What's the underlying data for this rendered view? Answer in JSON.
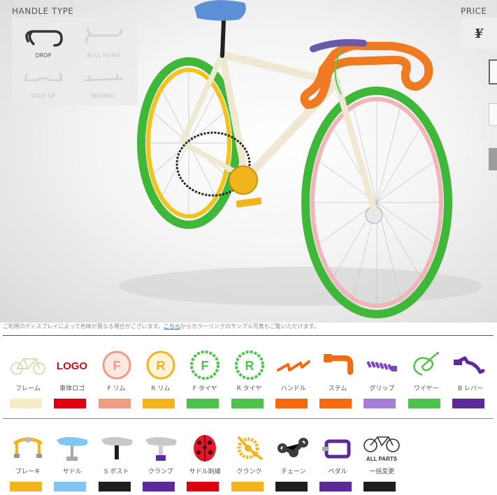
{
  "handle_panel": {
    "title": "HANDLE TYPE",
    "options": [
      {
        "label": "DROP",
        "active": true
      },
      {
        "label": "BULL HORN",
        "active": false
      },
      {
        "label": "WIDE UP",
        "active": false
      },
      {
        "label": "NORMAL",
        "active": false
      }
    ]
  },
  "price_panel": {
    "title": "PRICE",
    "value": "¥"
  },
  "bike_colors": {
    "frame": "#f1ecd8",
    "front_tire": "#3fb83a",
    "rear_tire": "#3fb83a",
    "front_rim": "#f1b4b8",
    "rear_rim": "#f5c219",
    "handlebar": "#f07a22",
    "grip": "#6a5aa8",
    "wire": "#4fcf4f",
    "crank": "#f0b51d",
    "saddle": "#5b8fd6",
    "chain": "#222222"
  },
  "notice": {
    "before": "ご利用のディスプレイによって色味が異なる場合がございます。",
    "link": "こちら",
    "after": "からカラーリングのサンプル写真もご覧いただけます。"
  },
  "parts_row1": [
    {
      "id": "frame",
      "label": "フレーム",
      "color": "#f3ecc4",
      "icon": "frame-icon"
    },
    {
      "id": "logo",
      "label": "車体ロゴ",
      "color": "#dd0011",
      "icon": "logo-icon",
      "icon_text": "LOGO"
    },
    {
      "id": "frim",
      "label": "F リム",
      "color": "#ef9b86",
      "icon": "f-rim-icon",
      "icon_text": "F"
    },
    {
      "id": "rrim",
      "label": "R リム",
      "color": "#f5b321",
      "icon": "r-rim-icon",
      "icon_text": "R"
    },
    {
      "id": "ftire",
      "label": "F タイヤ",
      "color": "#4ec24b",
      "icon": "f-tire-icon",
      "icon_text": "F"
    },
    {
      "id": "rtire",
      "label": "R タイヤ",
      "color": "#4ec24b",
      "icon": "r-tire-icon",
      "icon_text": "R"
    },
    {
      "id": "handle",
      "label": "ハンドル",
      "color": "#f7690f",
      "icon": "handlebar-icon"
    },
    {
      "id": "stem",
      "label": "ステム",
      "color": "#f7690f",
      "icon": "stem-icon"
    },
    {
      "id": "grip",
      "label": "グリップ",
      "color": "#a57ed6",
      "icon": "grip-icon"
    },
    {
      "id": "wire",
      "label": "ワイヤー",
      "color": "#4ec24b",
      "icon": "wire-icon"
    },
    {
      "id": "blever",
      "label": "B レバー",
      "color": "#5e2a9b",
      "icon": "brake-lever-icon"
    }
  ],
  "parts_row2": [
    {
      "id": "brake",
      "label": "ブレーキ",
      "color": "#f5b321",
      "icon": "brake-icon"
    },
    {
      "id": "saddle",
      "label": "サドル",
      "color": "#7fc6f2",
      "icon": "saddle-icon"
    },
    {
      "id": "spost",
      "label": "S ポスト",
      "color": "#1e1e1e",
      "icon": "seat-post-icon"
    },
    {
      "id": "clamp",
      "label": "クランプ",
      "color": "#5e2a9b",
      "icon": "clamp-icon"
    },
    {
      "id": "saddle_emb",
      "label": "サドル刺繍",
      "color": "#dd0011",
      "icon": "saddle-embroidery-icon"
    },
    {
      "id": "crank",
      "label": "クランク",
      "color": "#f5b321",
      "icon": "crank-icon"
    },
    {
      "id": "chain",
      "label": "チェーン",
      "color": "#1e1e1e",
      "icon": "chain-icon"
    },
    {
      "id": "pedal",
      "label": "ペダル",
      "color": "#5e2a9b",
      "icon": "pedal-icon"
    },
    {
      "id": "allparts",
      "label": "一括変更",
      "color": "#1e1e1e",
      "icon": "all-parts-icon",
      "icon_text": "ALL PARTS"
    }
  ]
}
